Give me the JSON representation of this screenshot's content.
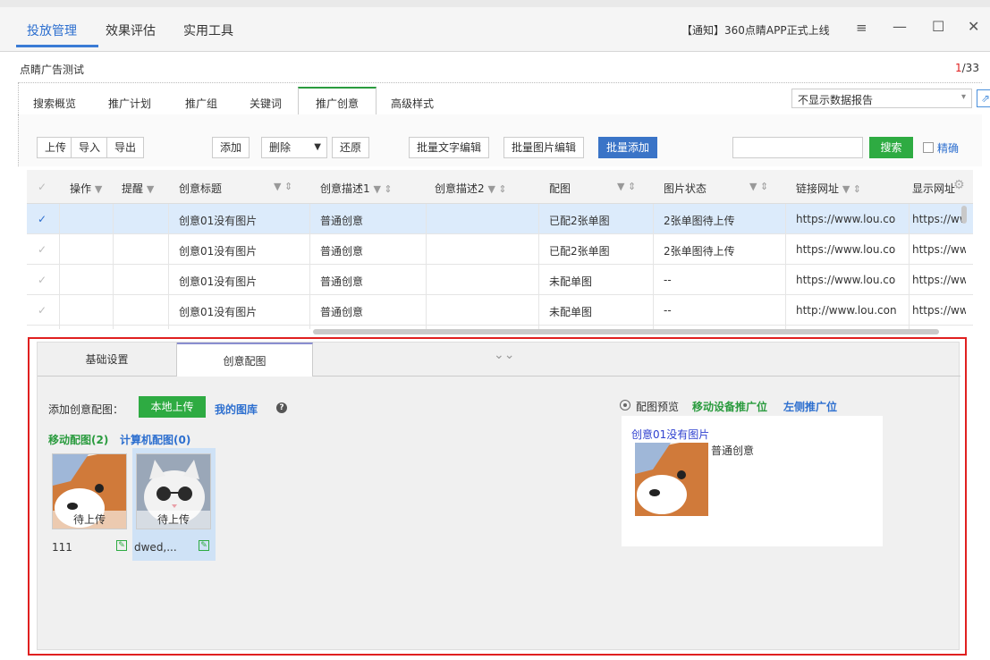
{
  "menu": {
    "items": [
      "投放管理",
      "效果评估",
      "实用工具"
    ],
    "notice": "【通知】360点睛APP正式上线"
  },
  "account": {
    "name": "点睛广告测试",
    "page_current": "1",
    "page_total": "/33"
  },
  "tabs": [
    "搜索概览",
    "推广计划",
    "推广组",
    "关键词",
    "推广创意",
    "高级样式"
  ],
  "report_select": "不显示数据报告",
  "toolbar": {
    "upload": "上传",
    "import": "导入",
    "export": "导出",
    "add": "添加",
    "delete": "删除",
    "restore": "还原",
    "batch_text": "批量文字编辑",
    "batch_image": "批量图片编辑",
    "batch_add": "批量添加",
    "search": "搜索",
    "exact": "精确"
  },
  "table": {
    "headers": [
      "操作",
      "提醒",
      "创意标题",
      "创意描述1",
      "创意描述2",
      "配图",
      "图片状态",
      "链接网址",
      "显示网址"
    ],
    "rows": [
      {
        "title": "创意01没有图片",
        "desc1": "普通创意",
        "desc2": "",
        "image": "已配2张单图",
        "img_status": "2张单图待上传",
        "link": "https://www.lou.co",
        "display": "https://ww"
      },
      {
        "title": "创意01没有图片",
        "desc1": "普通创意",
        "desc2": "",
        "image": "已配2张单图",
        "img_status": "2张单图待上传",
        "link": "https://www.lou.co",
        "display": "https://ww"
      },
      {
        "title": "创意01没有图片",
        "desc1": "普通创意",
        "desc2": "",
        "image": "未配单图",
        "img_status": "--",
        "link": "https://www.lou.co",
        "display": "https://ww"
      },
      {
        "title": "创意01没有图片",
        "desc1": "普通创意",
        "desc2": "",
        "image": "未配单图",
        "img_status": "--",
        "link": "http://www.lou.con",
        "display": "https://ww"
      }
    ]
  },
  "panel": {
    "tab_basic": "基础设置",
    "tab_images": "创意配图",
    "add_label": "添加创意配图：",
    "local_upload": "本地上传",
    "my_gallery": "我的图库",
    "mobile_images": "移动配图(2)",
    "pc_images": "计算机配图(0)",
    "images": [
      {
        "status": "待上传",
        "name": "111"
      },
      {
        "status": "待上传",
        "name": "dwed,..."
      }
    ],
    "preview_label": "配图预览",
    "preview_mobile": "移动设备推广位",
    "preview_left": "左侧推广位",
    "preview_title": "创意01没有图片",
    "preview_desc": "普通创意"
  },
  "colors": {
    "accent_blue": "#2d6fcf",
    "green": "#2eab42",
    "highlight_red": "#e02020"
  }
}
